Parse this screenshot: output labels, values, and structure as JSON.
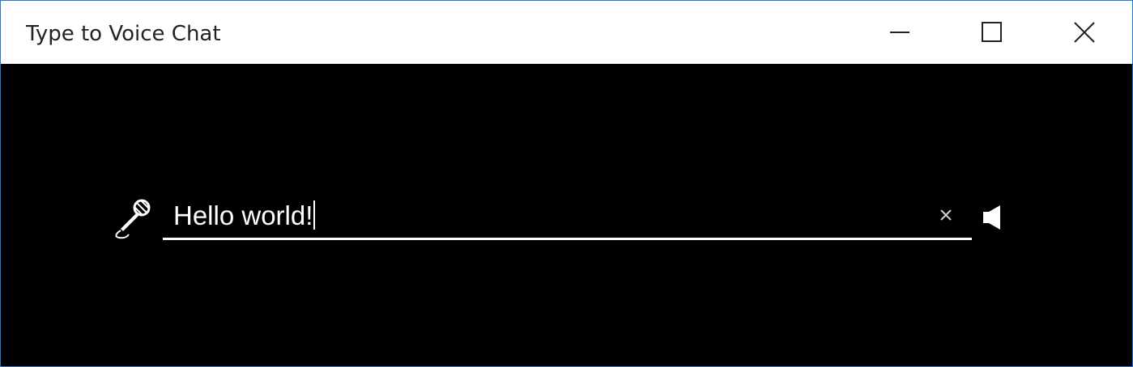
{
  "window": {
    "title": "Type to Voice Chat",
    "accent_color": "#2b78d4",
    "background_color": "#000000"
  },
  "caption_buttons": {
    "minimize_icon": "minimize-icon",
    "maximize_icon": "maximize-icon",
    "close_icon": "close-icon"
  },
  "chat": {
    "microphone_icon": "microphone-icon",
    "input_value": "Hello world!",
    "clear_icon": "clear-icon",
    "speak_icon": "speaker-icon"
  }
}
